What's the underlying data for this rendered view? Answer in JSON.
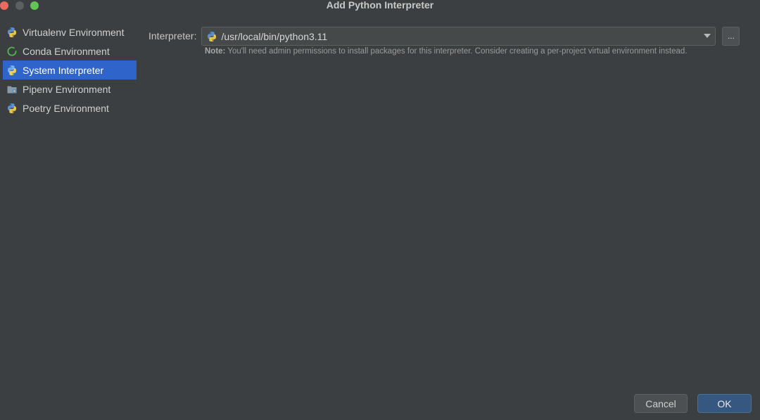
{
  "window": {
    "title": "Add Python Interpreter"
  },
  "sidebar": {
    "items": [
      {
        "label": "Virtualenv Environment",
        "icon": "python-icon",
        "selected": false
      },
      {
        "label": "Conda Environment",
        "icon": "conda-icon",
        "selected": false
      },
      {
        "label": "System Interpreter",
        "icon": "python-icon",
        "selected": true
      },
      {
        "label": "Pipenv Environment",
        "icon": "pipenv-icon",
        "selected": false
      },
      {
        "label": "Poetry Environment",
        "icon": "python-icon",
        "selected": false
      }
    ]
  },
  "form": {
    "interpreter_label": "Interpreter:",
    "interpreter_value": "/usr/local/bin/python3.11",
    "browse_label": "...",
    "note_prefix": "Note:",
    "note_text": " You'll need admin permissions to install packages for this interpreter. Consider creating a per-project virtual environment instead."
  },
  "buttons": {
    "cancel": "Cancel",
    "ok": "OK"
  },
  "colors": {
    "background": "#3c3f41",
    "selection": "#2f65ca",
    "ok_button": "#365880"
  }
}
